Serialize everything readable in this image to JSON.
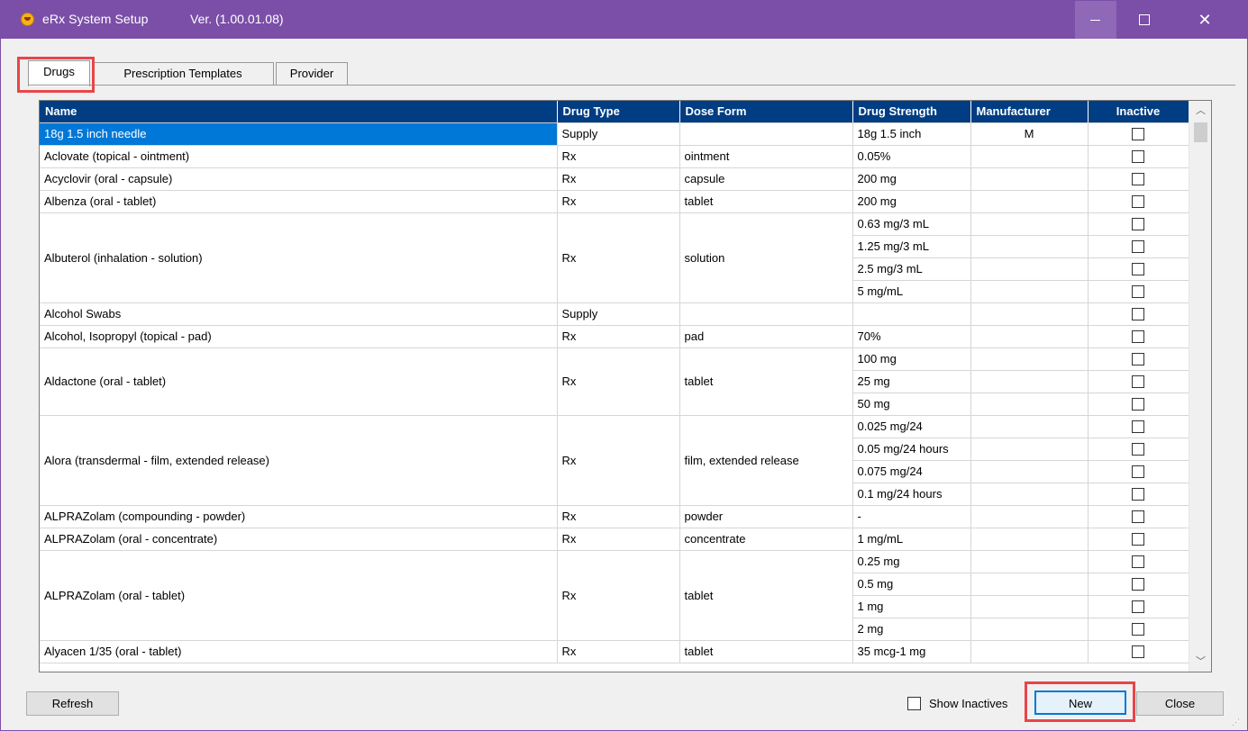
{
  "window": {
    "title": "eRx System Setup",
    "version": "Ver. (1.00.01.08)",
    "accent": "#7b4fa8",
    "minimize_icon": "minimize-icon",
    "maximize_icon": "maximize-icon",
    "close_icon": "close-icon",
    "close_glyph": "✕"
  },
  "tabs": [
    {
      "label": "Drugs",
      "active": true
    },
    {
      "label": "Prescription Templates",
      "active": false
    },
    {
      "label": "Provider",
      "active": false
    }
  ],
  "grid": {
    "columns": [
      "Name",
      "Drug Type",
      "Dose Form",
      "Drug Strength",
      "Manufacturer",
      "Inactive"
    ],
    "header_color": "#003d82",
    "selection_color": "#0078d7",
    "rows": [
      {
        "name": "18g 1.5 inch needle",
        "type": "Supply",
        "form": "",
        "strengths": [
          "18g 1.5 inch"
        ],
        "manufacturer": "M",
        "selected": true
      },
      {
        "name": "Aclovate (topical - ointment)",
        "type": "Rx",
        "form": "ointment",
        "strengths": [
          "0.05%"
        ],
        "manufacturer": ""
      },
      {
        "name": "Acyclovir (oral - capsule)",
        "type": "Rx",
        "form": "capsule",
        "strengths": [
          "200 mg"
        ],
        "manufacturer": ""
      },
      {
        "name": "Albenza (oral - tablet)",
        "type": "Rx",
        "form": "tablet",
        "strengths": [
          "200 mg"
        ],
        "manufacturer": ""
      },
      {
        "name": "Albuterol (inhalation - solution)",
        "type": "Rx",
        "form": "solution",
        "strengths": [
          "0.63 mg/3 mL",
          "1.25 mg/3 mL",
          "2.5 mg/3 mL",
          "5 mg/mL"
        ],
        "manufacturer": ""
      },
      {
        "name": "Alcohol Swabs",
        "type": "Supply",
        "form": "",
        "strengths": [
          ""
        ],
        "manufacturer": ""
      },
      {
        "name": "Alcohol, Isopropyl (topical - pad)",
        "type": "Rx",
        "form": "pad",
        "strengths": [
          "70%"
        ],
        "manufacturer": ""
      },
      {
        "name": "Aldactone (oral - tablet)",
        "type": "Rx",
        "form": "tablet",
        "strengths": [
          "100 mg",
          "25 mg",
          "50 mg"
        ],
        "manufacturer": ""
      },
      {
        "name": "Alora (transdermal - film, extended release)",
        "type": "Rx",
        "form": "film, extended release",
        "strengths": [
          "0.025 mg/24",
          "0.05 mg/24 hours",
          "0.075 mg/24",
          "0.1 mg/24 hours"
        ],
        "manufacturer": ""
      },
      {
        "name": "ALPRAZolam (compounding - powder)",
        "type": "Rx",
        "form": "powder",
        "strengths": [
          "-"
        ],
        "manufacturer": ""
      },
      {
        "name": "ALPRAZolam (oral - concentrate)",
        "type": "Rx",
        "form": "concentrate",
        "strengths": [
          "1 mg/mL"
        ],
        "manufacturer": ""
      },
      {
        "name": "ALPRAZolam (oral - tablet)",
        "type": "Rx",
        "form": "tablet",
        "strengths": [
          "0.25 mg",
          "0.5 mg",
          "1 mg",
          "2 mg"
        ],
        "manufacturer": ""
      },
      {
        "name": "Alyacen 1/35 (oral - tablet)",
        "type": "Rx",
        "form": "tablet",
        "strengths": [
          "35 mcg-1 mg"
        ],
        "manufacturer": ""
      }
    ]
  },
  "scrollbar": {
    "up_icon": "chevron-up-icon",
    "down_icon": "chevron-down-icon",
    "up_glyph": "︿",
    "down_glyph": "﹀"
  },
  "footer": {
    "refresh_label": "Refresh",
    "show_inactives_label": "Show Inactives",
    "show_inactives_checked": false,
    "new_label": "New",
    "close_label": "Close",
    "highlight_color": "#e8454a"
  }
}
